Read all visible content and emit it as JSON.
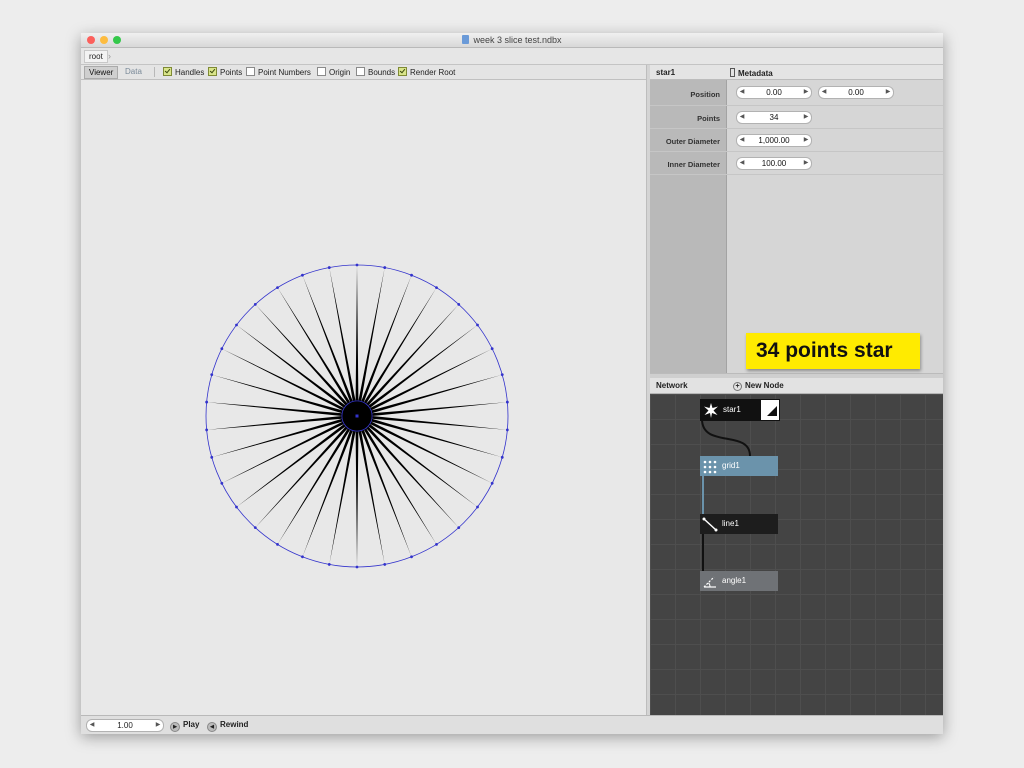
{
  "window": {
    "title": "week 3 slice test.ndbx"
  },
  "breadcrumb": {
    "root": "root"
  },
  "viewer": {
    "tabs": {
      "viewer": "Viewer",
      "data": "Data"
    },
    "options": {
      "handles": {
        "label": "Handles",
        "checked": true
      },
      "points": {
        "label": "Points",
        "checked": true
      },
      "point_numbers": {
        "label": "Point Numbers",
        "checked": false
      },
      "origin": {
        "label": "Origin",
        "checked": false
      },
      "bounds": {
        "label": "Bounds",
        "checked": false
      },
      "render_root": {
        "label": "Render Root",
        "checked": true
      }
    },
    "star": {
      "points": 34,
      "outer_diameter": 1000,
      "inner_diameter": 100
    },
    "colors": {
      "canvas": "#e8e8e8",
      "shape": "#000000",
      "handles": "#3333cc"
    }
  },
  "properties": {
    "node_name": "star1",
    "metadata_label": "Metadata",
    "position_label": "Position",
    "position_x": "0.00",
    "position_y": "0.00",
    "points_label": "Points",
    "points_value": "34",
    "outer_label": "Outer Diameter",
    "outer_value": "1,000.00",
    "inner_label": "Inner Diameter",
    "inner_value": "100.00"
  },
  "network": {
    "title": "Network",
    "new_node": "New Node",
    "nodes": {
      "star": "star1",
      "grid": "grid1",
      "line": "line1",
      "angle": "angle1"
    }
  },
  "bottom": {
    "frame": "1.00",
    "play": "Play",
    "rewind": "Rewind"
  },
  "callout": {
    "text": "34 points star"
  }
}
